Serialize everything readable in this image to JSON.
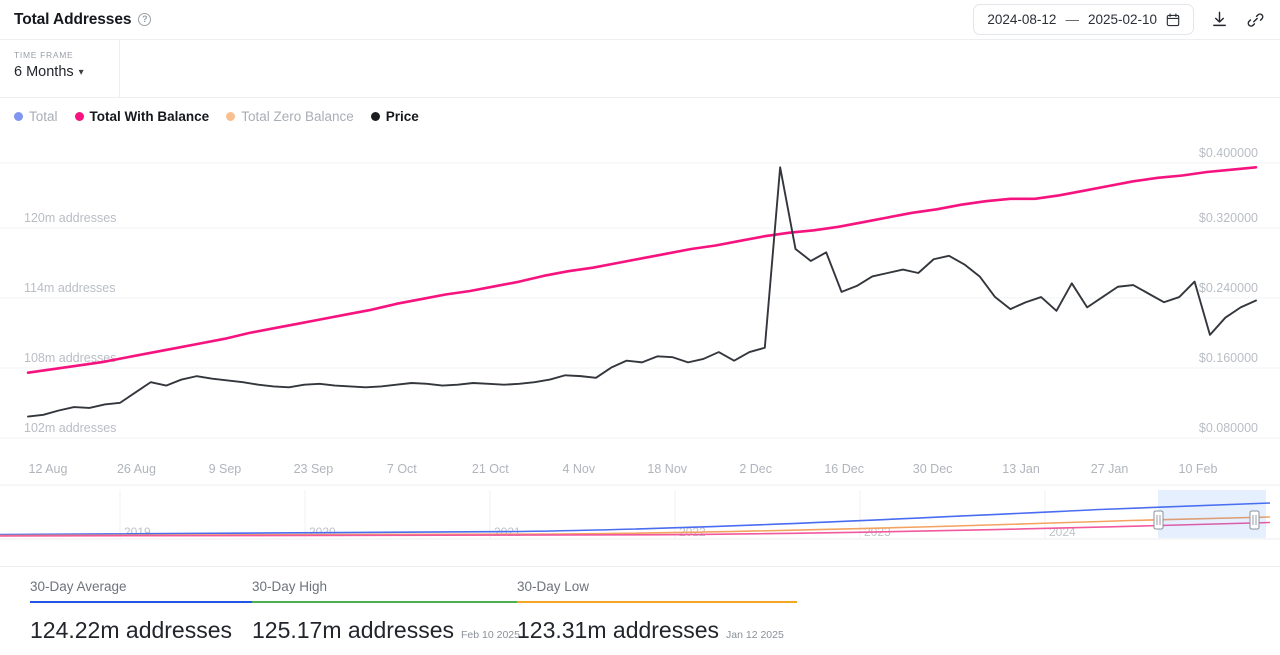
{
  "header": {
    "title": "Total Addresses",
    "help_icon": "question-circle-icon",
    "date_start": "2024-08-12",
    "date_separator": "—",
    "date_end": "2025-02-10",
    "calendar_icon": "calendar-icon",
    "download_icon": "download-icon",
    "link_icon": "link-icon"
  },
  "timeframe": {
    "label": "TIME FRAME",
    "value": "6 Months",
    "chevron": "chevron-down-icon"
  },
  "legend": [
    {
      "label": "Total",
      "color": "#7f95ef",
      "active": false
    },
    {
      "label": "Total With Balance",
      "color": "#f6137f",
      "active": true
    },
    {
      "label": "Total Zero Balance",
      "color": "#f9bf8e",
      "active": false
    },
    {
      "label": "Price",
      "color": "#1b1d21",
      "active": true
    }
  ],
  "chart_data": {
    "type": "line",
    "title": "Total Addresses",
    "xlabel": "",
    "ylabel": "addresses",
    "y_left_ticks": [
      "120m addresses",
      "114m addresses",
      "108m addresses",
      "102m addresses"
    ],
    "y_left_values": [
      120,
      114,
      108,
      102
    ],
    "y_right_ticks": [
      "$0.400000",
      "$0.320000",
      "$0.240000",
      "$0.160000",
      "$0.080000"
    ],
    "y_right_values": [
      0.4,
      0.32,
      0.24,
      0.16,
      0.08
    ],
    "y_left_unit": "m addresses",
    "y_right_unit": "USD",
    "grid": true,
    "legend_position": "top-left",
    "x_ticks": [
      "12 Aug",
      "26 Aug",
      "9 Sep",
      "23 Sep",
      "7 Oct",
      "21 Oct",
      "4 Nov",
      "18 Nov",
      "2 Dec",
      "16 Dec",
      "30 Dec",
      "13 Jan",
      "27 Jan",
      "10 Feb"
    ],
    "series": [
      {
        "name": "Total With Balance",
        "color": "#f6137f",
        "axis": "left",
        "unit": "m addresses",
        "values": [
          107.6,
          107.9,
          108.2,
          108.5,
          108.9,
          109.3,
          109.7,
          110.1,
          110.5,
          111.0,
          111.4,
          111.8,
          112.2,
          112.6,
          113.0,
          113.5,
          113.9,
          114.3,
          114.6,
          115.0,
          115.4,
          115.9,
          116.3,
          116.6,
          117.0,
          117.4,
          117.8,
          118.2,
          118.5,
          118.9,
          119.3,
          119.6,
          119.8,
          120.1,
          120.5,
          120.9,
          121.3,
          121.6,
          122.0,
          122.3,
          122.5,
          122.5,
          122.8,
          123.2,
          123.6,
          124.0,
          124.3,
          124.5,
          124.8,
          125.0,
          125.2
        ]
      },
      {
        "name": "Price",
        "color": "#33363c",
        "axis": "right",
        "unit": "USD",
        "values": [
          0.105,
          0.107,
          0.112,
          0.116,
          0.115,
          0.119,
          0.121,
          0.133,
          0.145,
          0.141,
          0.148,
          0.152,
          0.149,
          0.147,
          0.145,
          0.142,
          0.14,
          0.139,
          0.142,
          0.143,
          0.141,
          0.14,
          0.139,
          0.14,
          0.142,
          0.144,
          0.143,
          0.141,
          0.142,
          0.144,
          0.143,
          0.142,
          0.143,
          0.145,
          0.148,
          0.153,
          0.152,
          0.15,
          0.162,
          0.17,
          0.168,
          0.175,
          0.174,
          0.168,
          0.172,
          0.18,
          0.17,
          0.18,
          0.185,
          0.395,
          0.3,
          0.286,
          0.296,
          0.25,
          0.257,
          0.268,
          0.272,
          0.276,
          0.272,
          0.288,
          0.292,
          0.282,
          0.268,
          0.244,
          0.23,
          0.238,
          0.244,
          0.228,
          0.26,
          0.232,
          0.244,
          0.256,
          0.258,
          0.248,
          0.238,
          0.244,
          0.262,
          0.2,
          0.22,
          0.232,
          0.24
        ]
      }
    ],
    "navigator": {
      "year_ticks": [
        "2019",
        "2020",
        "2021",
        "2022",
        "2023",
        "2024"
      ],
      "selection_start": "2024-08-12",
      "selection_end": "2025-02-10",
      "series_colors": [
        "#4a6cf0",
        "#f4a261",
        "#f6137f"
      ]
    }
  },
  "stats": [
    {
      "label": "30-Day Average",
      "rule_color": "#2255e6",
      "value": "124.22m addresses",
      "date": ""
    },
    {
      "label": "30-Day High",
      "rule_color": "#4caf50",
      "value": "125.17m addresses",
      "date": "Feb 10 2025"
    },
    {
      "label": "30-Day Low",
      "rule_color": "#f5a623",
      "value": "123.31m addresses",
      "date": "Jan 12 2025"
    }
  ]
}
